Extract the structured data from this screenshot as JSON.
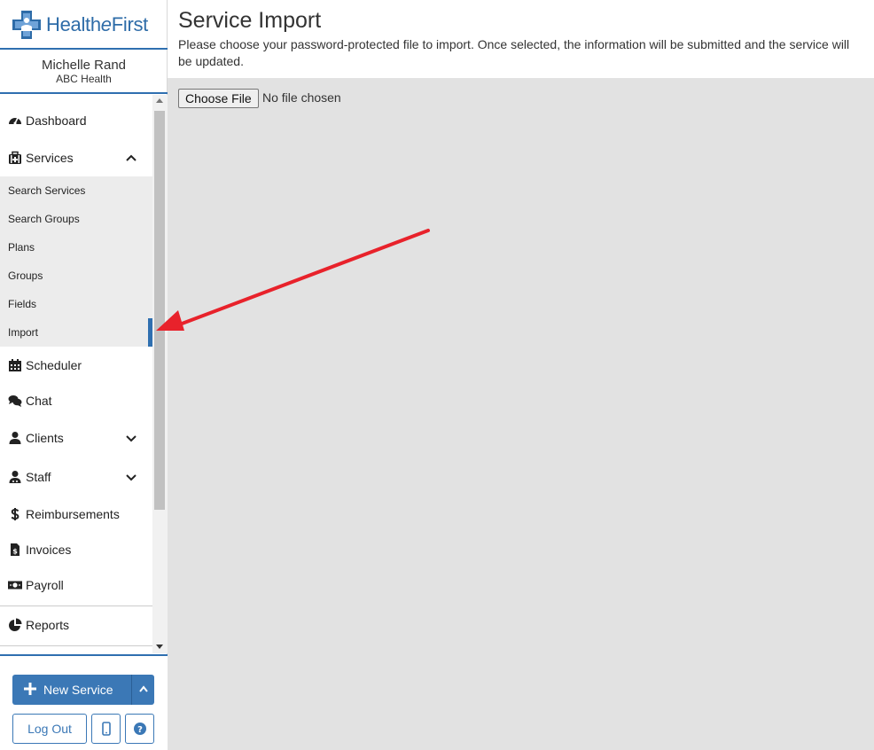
{
  "brand": {
    "name_part1": "Health",
    "name_italic": "e",
    "name_part2": "First"
  },
  "user": {
    "name": "Michelle Rand",
    "org": "ABC Health"
  },
  "nav": {
    "dashboard": "Dashboard",
    "services": "Services",
    "services_sub": [
      "Search Services",
      "Search Groups",
      "Plans",
      "Groups",
      "Fields",
      "Import"
    ],
    "scheduler": "Scheduler",
    "chat": "Chat",
    "clients": "Clients",
    "staff": "Staff",
    "reimbursements": "Reimbursements",
    "invoices": "Invoices",
    "payroll": "Payroll",
    "reports": "Reports"
  },
  "footer": {
    "new_service": "New Service",
    "log_out": "Log Out"
  },
  "page": {
    "title": "Service Import",
    "description": "Please choose your password-protected file to import. Once selected, the information will be submitted and the service will be updated.",
    "file_button": "Choose File",
    "file_status": "No file chosen"
  },
  "colors": {
    "accent": "#2f6fb0",
    "button": "#3b78b6",
    "annotation_arrow": "#e8222b",
    "content_bg": "#e2e2e2"
  },
  "icons": {
    "dashboard": "gauge-icon",
    "services": "medkit-icon",
    "scheduler": "calendar-icon",
    "chat": "comments-icon",
    "clients": "user-icon",
    "staff": "user-doctor-icon",
    "reimbursements": "dollar-icon",
    "invoices": "invoice-icon",
    "payroll": "money-bill-icon",
    "reports": "pie-chart-icon"
  }
}
